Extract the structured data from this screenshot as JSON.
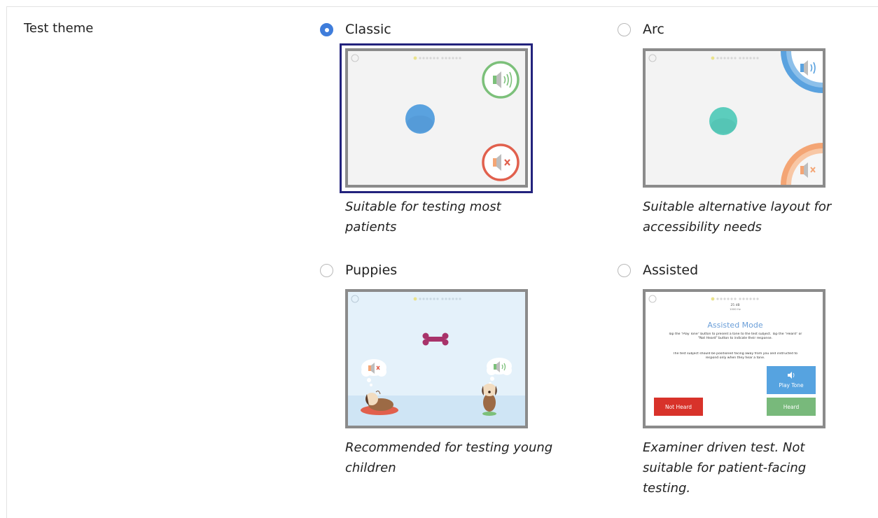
{
  "section": {
    "label": "Test theme"
  },
  "themes": [
    {
      "id": "classic",
      "name": "Classic",
      "selected": true,
      "description": "Suitable for testing most patients"
    },
    {
      "id": "arc",
      "name": "Arc",
      "selected": false,
      "description": "Suitable alternative layout for accessibility needs"
    },
    {
      "id": "puppies",
      "name": "Puppies",
      "selected": false,
      "description": "Recommended for testing young children"
    },
    {
      "id": "assisted",
      "name": "Assisted",
      "selected": false,
      "description": "Examiner driven test. Not suitable for patient-facing testing."
    }
  ],
  "assisted_preview": {
    "title": "Assisted Mode",
    "db_value": "25 dB",
    "hz_value": "1000 Hz",
    "instruction1": "Tap the \"Play Tone\" button to present a tone to the test subject. Tap the \"Heard\" or \"Not Heard\" button to indicate their response.",
    "instruction2": "The test subject should be positioned facing away from you and instructed to respond only when they hear a tone.",
    "play_tone": "Play Tone",
    "not_heard": "Not Heard",
    "heard": "Heard"
  },
  "colors": {
    "radio_selected": "#3f7ddb",
    "focus_ring": "#23237d",
    "green": "#7cc07a",
    "red": "#e1604d",
    "blue": "#5aa2df",
    "teal": "#5ccdbd",
    "orange": "#f4a574",
    "not_heard_btn": "#d8322a",
    "heard_btn": "#78b97b",
    "play_btn": "#56a3e0"
  }
}
